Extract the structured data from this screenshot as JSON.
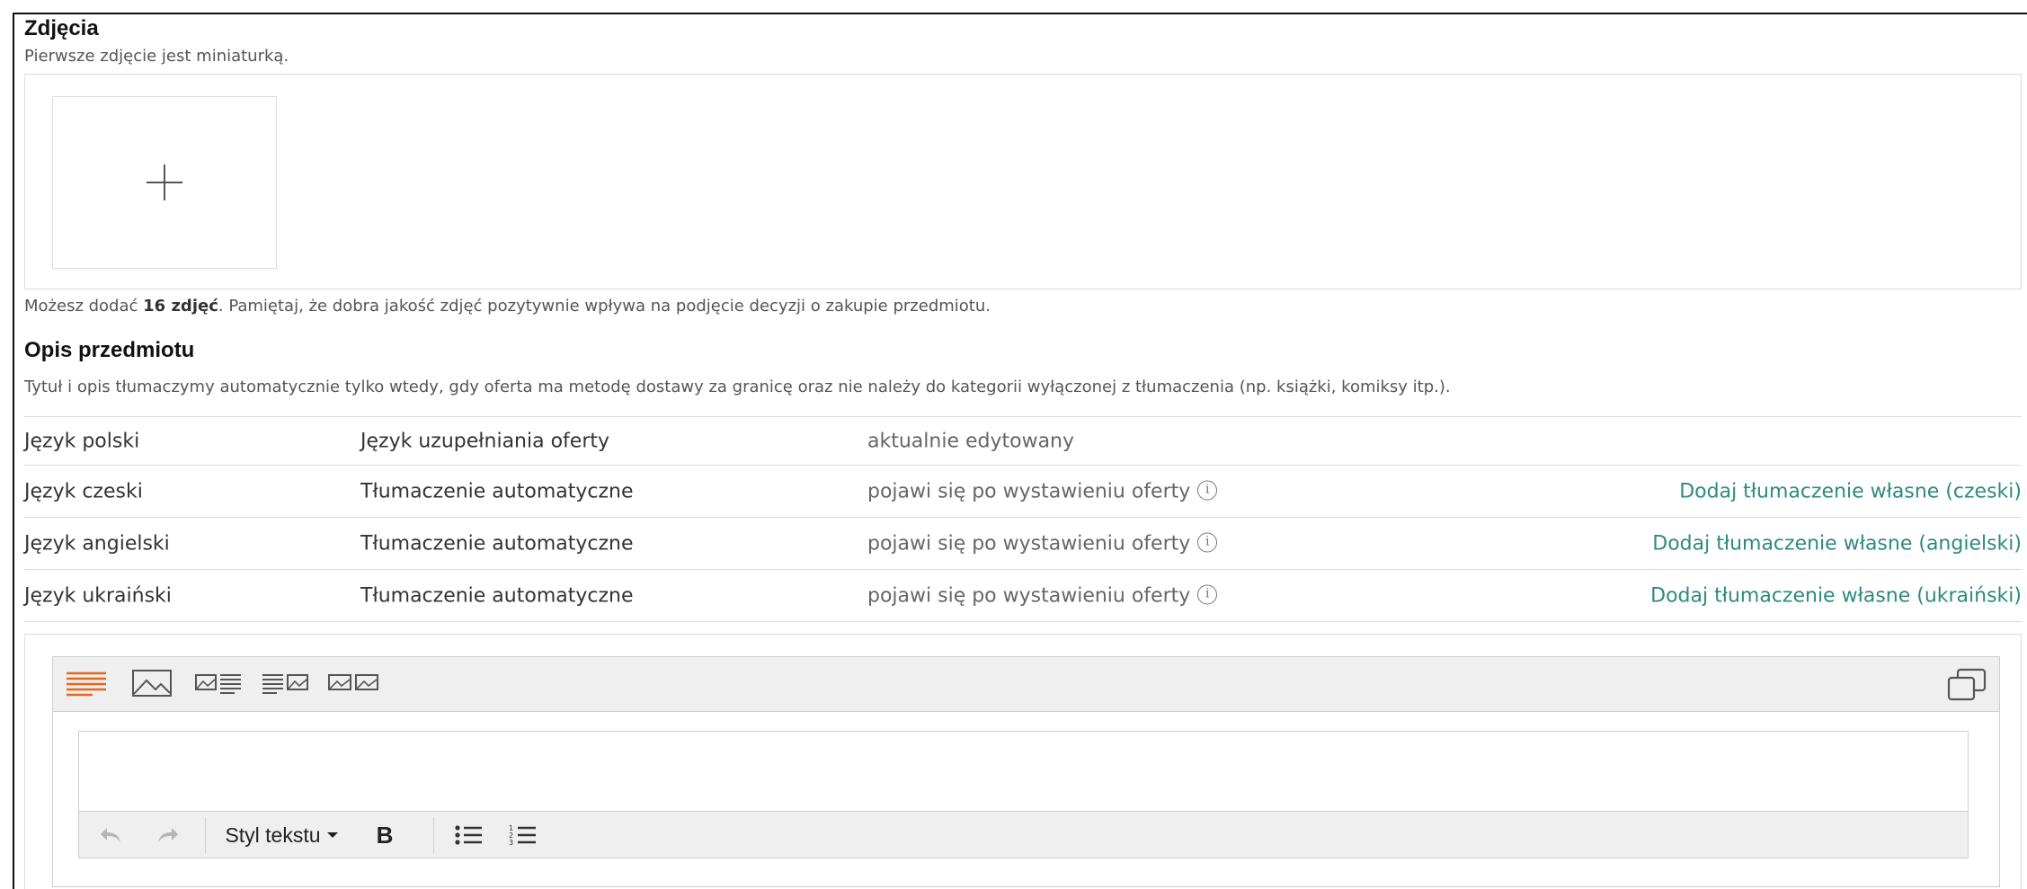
{
  "photos": {
    "title": "Zdjęcia",
    "subtitle": "Pierwsze zdjęcie jest miniaturką.",
    "hint_prefix": "Możesz dodać ",
    "hint_count": "16 zdjęć",
    "hint_suffix": ". Pamiętaj, że dobra jakość zdjęć pozytywnie wpływa na podjęcie decyzji o zakupie przedmiotu."
  },
  "description": {
    "title": "Opis przedmiotu",
    "note": "Tytuł i opis tłumaczymy automatycznie tylko wtedy, gdy oferta ma metodę dostawy za granicę oraz nie należy do kategorii wyłączonej z tłumaczenia (np. książki, komiksy itp.).",
    "languages": [
      {
        "language": "Język polski",
        "type": "Język uzupełniania oferty",
        "status": "aktualnie edytowany",
        "action": ""
      },
      {
        "language": "Język czeski",
        "type": "Tłumaczenie automatyczne",
        "status": "pojawi się po wystawieniu oferty",
        "action": "Dodaj tłumaczenie własne (czeski)"
      },
      {
        "language": "Język angielski",
        "type": "Tłumaczenie automatyczne",
        "status": "pojawi się po wystawieniu oferty",
        "action": "Dodaj tłumaczenie własne (angielski)"
      },
      {
        "language": "Język ukraiński",
        "type": "Tłumaczenie automatyczne",
        "status": "pojawi się po wystawieniu oferty",
        "action": "Dodaj tłumaczenie własne (ukraiński)"
      }
    ]
  },
  "editor": {
    "layout_icons": [
      "text-layout-icon",
      "image-layout-icon",
      "image-text-layout-icon",
      "text-image-layout-icon",
      "two-images-layout-icon"
    ],
    "style_dropdown_label": "Styl tekstu",
    "bold_label": "B",
    "text_value": ""
  },
  "colors": {
    "accent": "#e8671c",
    "link": "#2e8a7f",
    "border": "#dcdcdc",
    "toolbar_bg": "#efefef"
  }
}
